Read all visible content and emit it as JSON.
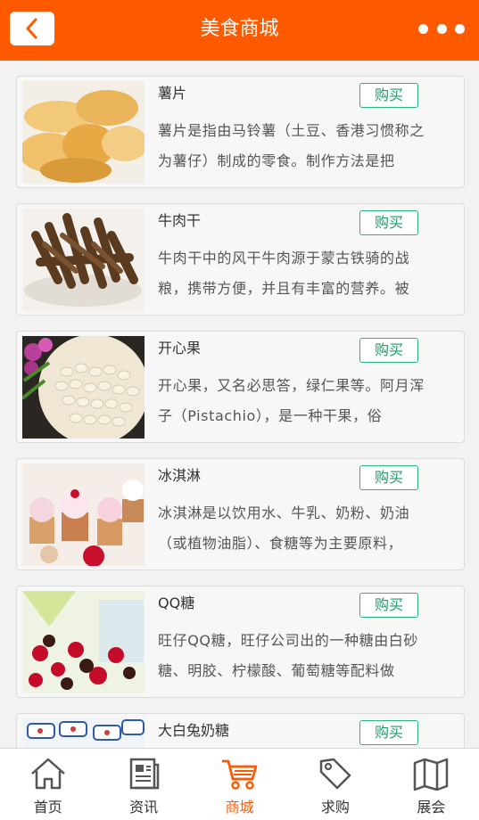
{
  "header": {
    "title": "美食商城"
  },
  "products": [
    {
      "name": "薯片",
      "buy_label": "购买",
      "desc": "薯片是指由马铃薯（土豆、香港习惯称之为薯仔）制成的零食。制作方法是把"
    },
    {
      "name": "牛肉干",
      "buy_label": "购买",
      "desc": "牛肉干中的风干牛肉源于蒙古铁骑的战粮，携带方便，并且有丰富的营养。被"
    },
    {
      "name": "开心果",
      "buy_label": "购买",
      "desc": "开心果，又名必思答，绿仁果等。阿月浑子（Pistachio），是一种干果，俗"
    },
    {
      "name": "冰淇淋",
      "buy_label": "购买",
      "desc": "冰淇淋是以饮用水、牛乳、奶粉、奶油（或植物油脂）、食糖等为主要原料，"
    },
    {
      "name": "QQ糖",
      "buy_label": "购买",
      "desc": "旺仔QQ糖，旺仔公司出的一种糖由白砂糖、明胶、柠檬酸、葡萄糖等配料做"
    },
    {
      "name": "大白兔奶糖",
      "buy_label": "购买",
      "desc": ""
    }
  ],
  "tabbar": {
    "items": [
      {
        "label": "首页",
        "icon": "home-icon"
      },
      {
        "label": "资讯",
        "icon": "news-icon"
      },
      {
        "label": "商城",
        "icon": "cart-icon",
        "active": true
      },
      {
        "label": "求购",
        "icon": "tag-icon"
      },
      {
        "label": "展会",
        "icon": "map-icon"
      }
    ]
  },
  "colors": {
    "accent": "#ff5a00",
    "buy_border": "#28b67e"
  }
}
